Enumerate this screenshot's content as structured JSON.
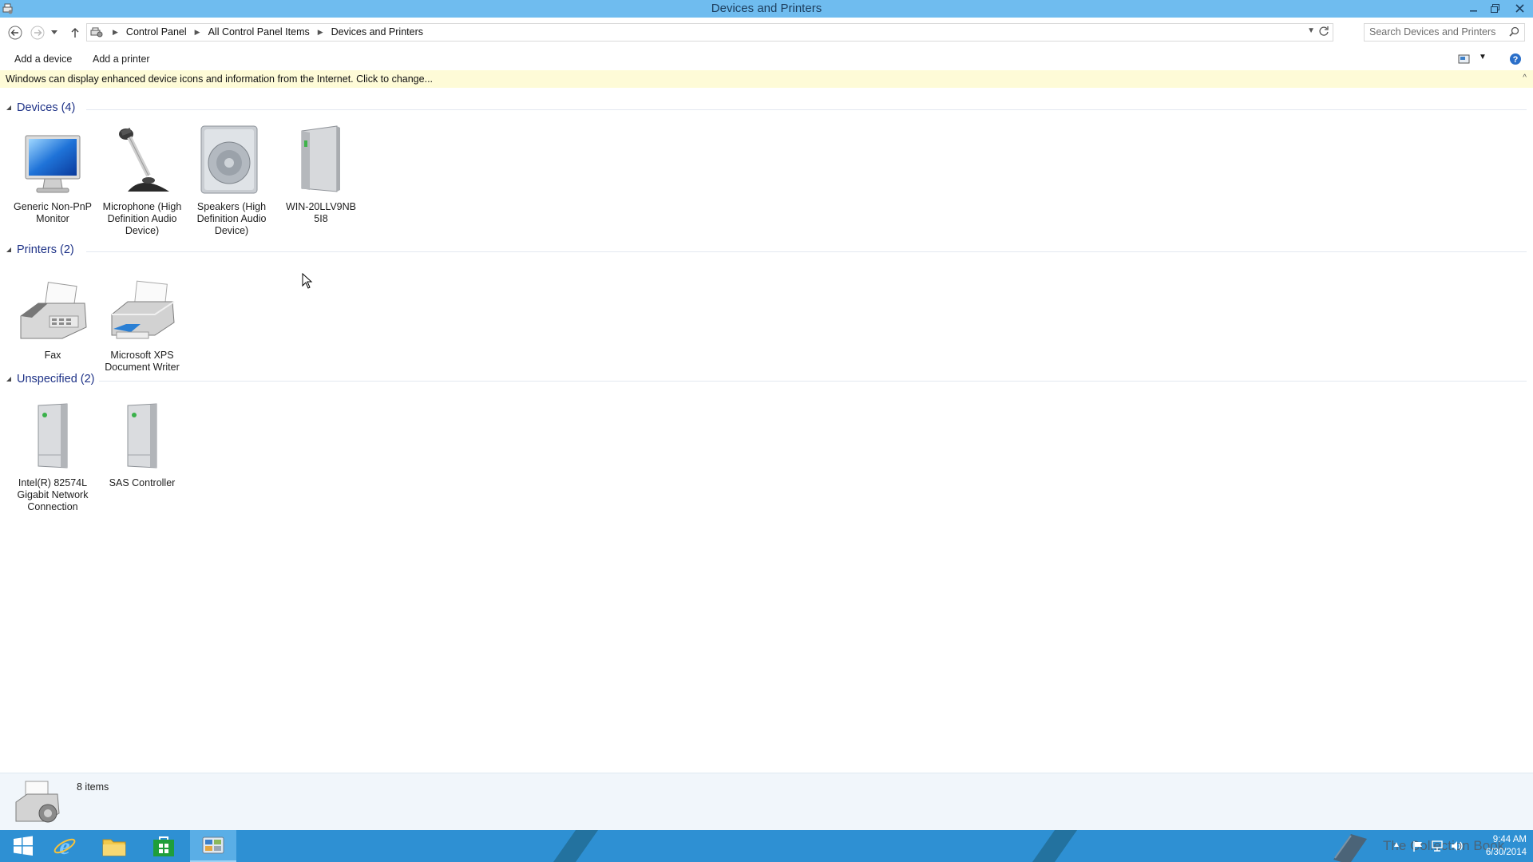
{
  "window": {
    "title": "Devices and Printers"
  },
  "address": {
    "crumbs": [
      "Control Panel",
      "All Control Panel Items",
      "Devices and Printers"
    ]
  },
  "search": {
    "placeholder": "Search Devices and Printers"
  },
  "commands": {
    "add_device": "Add a device",
    "add_printer": "Add a printer"
  },
  "infobar": {
    "message": "Windows can display enhanced device icons and information from the Internet. Click to change..."
  },
  "groups": {
    "devices": {
      "label": "Devices (4)",
      "items": [
        {
          "name": "Generic Non-PnP Monitor",
          "icon": "monitor-icon"
        },
        {
          "name": "Microphone (High Definition Audio Device)",
          "icon": "microphone-icon"
        },
        {
          "name": "Speakers (High Definition Audio Device)",
          "icon": "speaker-icon"
        },
        {
          "name": "WIN-20LLV9NB5I8",
          "icon": "computer-icon"
        }
      ]
    },
    "printers": {
      "label": "Printers (2)",
      "items": [
        {
          "name": "Fax",
          "icon": "fax-icon"
        },
        {
          "name": "Microsoft XPS Document Writer",
          "icon": "printer-icon"
        }
      ]
    },
    "unspecified": {
      "label": "Unspecified (2)",
      "items": [
        {
          "name": "Intel(R) 82574L Gigabit Network Connection",
          "icon": "device-box-icon"
        },
        {
          "name": "SAS Controller",
          "icon": "device-box-icon"
        }
      ]
    }
  },
  "details": {
    "count": "8 items"
  },
  "taskbar": {
    "watermark": "The Collection Book",
    "time": "9:44 AM",
    "date": "6/30/2014"
  },
  "colors": {
    "titlebar": "#6fbcef",
    "taskbar": "#2e90d3",
    "infobar": "#fefbd7",
    "group_header": "#1e3287"
  }
}
